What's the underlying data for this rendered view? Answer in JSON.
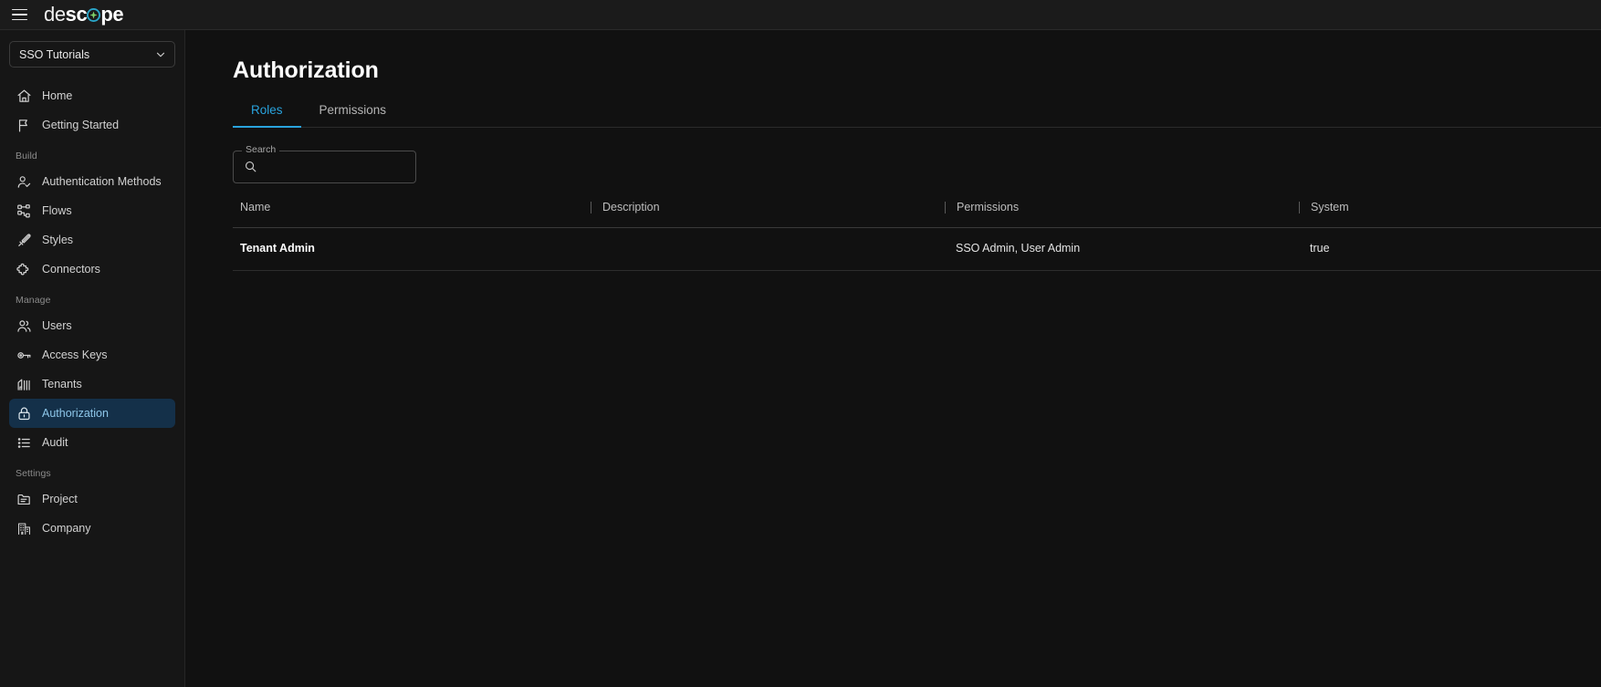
{
  "topbar": {
    "menu_icon": "hamburger-menu-icon",
    "logo": {
      "part1": "de",
      "part2": "sc",
      "mark": "descope-circle-star-mark",
      "part3": "pe"
    }
  },
  "sidebar": {
    "project_selector": {
      "value": "SSO Tutorials",
      "chevron_icon": "chevron-down-icon"
    },
    "groups": [
      {
        "label": "",
        "items": [
          {
            "label": "Home",
            "icon": "home-icon",
            "active": false
          },
          {
            "label": "Getting Started",
            "icon": "flag-icon",
            "active": false
          }
        ]
      },
      {
        "label": "Build",
        "items": [
          {
            "label": "Authentication Methods",
            "icon": "user-check-icon",
            "active": false
          },
          {
            "label": "Flows",
            "icon": "flow-sitemap-icon",
            "active": false
          },
          {
            "label": "Styles",
            "icon": "pen-brush-icon",
            "active": false
          },
          {
            "label": "Connectors",
            "icon": "puzzle-piece-icon",
            "active": false
          }
        ]
      },
      {
        "label": "Manage",
        "items": [
          {
            "label": "Users",
            "icon": "users-group-icon",
            "active": false
          },
          {
            "label": "Access Keys",
            "icon": "key-icon",
            "active": false
          },
          {
            "label": "Tenants",
            "icon": "building-tenants-icon",
            "active": false
          },
          {
            "label": "Authorization",
            "icon": "lock-icon",
            "active": true
          },
          {
            "label": "Audit",
            "icon": "list-icon",
            "active": false
          }
        ]
      },
      {
        "label": "Settings",
        "items": [
          {
            "label": "Project",
            "icon": "folder-icon",
            "active": false
          },
          {
            "label": "Company",
            "icon": "office-building-icon",
            "active": false
          }
        ]
      }
    ]
  },
  "main": {
    "page_title": "Authorization",
    "tabs": [
      {
        "label": "Roles",
        "active": true
      },
      {
        "label": "Permissions",
        "active": false
      }
    ],
    "search": {
      "legend": "Search",
      "value": "",
      "placeholder": "",
      "icon": "search-icon"
    },
    "table": {
      "columns": [
        {
          "label": "Name",
          "divider": false
        },
        {
          "label": "Description",
          "divider": true
        },
        {
          "label": "Permissions",
          "divider": true
        },
        {
          "label": "System",
          "divider": true
        }
      ],
      "rows": [
        {
          "name": "Tenant Admin",
          "description": "",
          "permissions": "SSO Admin, User Admin",
          "system": "true"
        }
      ]
    }
  },
  "colors": {
    "accent": "#29a3dd",
    "active_nav_bg": "#143049",
    "active_nav_text": "#8ec7ea",
    "page_bg": "#111111",
    "sidebar_bg": "#161616",
    "topbar_bg": "#1b1b1b"
  }
}
